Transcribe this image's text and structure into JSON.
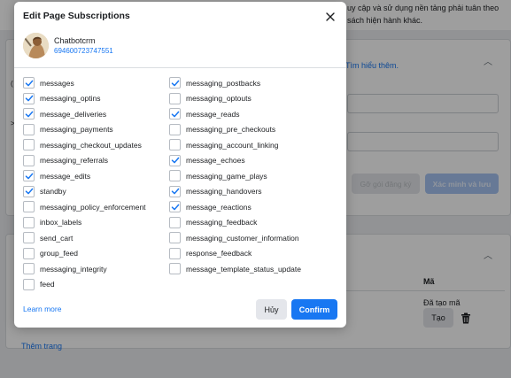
{
  "background": {
    "top_text_lines": [
      "uy cập và sử dụng nền tảng phải tuân theo",
      "sách hiện hành khác."
    ],
    "learn_more_link": "Tìm hiểu thêm.",
    "btn_register_plan": "Gỡ gói đăng ký",
    "btn_verify_save": "Xác minh và lưu",
    "table_col_header": "Mã",
    "token_status": "Đã tạo mã",
    "btn_create": "Tạo",
    "add_page_link": "Thêm trang"
  },
  "dialog": {
    "title": "Edit Page Subscriptions",
    "page_name": "Chatbotcrm",
    "page_id": "694600723747551",
    "learn_more": "Learn more",
    "cancel_label": "Hủy",
    "confirm_label": "Confirm",
    "left_fields": [
      {
        "label": "messages",
        "checked": true
      },
      {
        "label": "messaging_optins",
        "checked": true
      },
      {
        "label": "message_deliveries",
        "checked": true
      },
      {
        "label": "messaging_payments",
        "checked": false
      },
      {
        "label": "messaging_checkout_updates",
        "checked": false
      },
      {
        "label": "messaging_referrals",
        "checked": false
      },
      {
        "label": "message_edits",
        "checked": true
      },
      {
        "label": "standby",
        "checked": true
      },
      {
        "label": "messaging_policy_enforcement",
        "checked": false
      },
      {
        "label": "inbox_labels",
        "checked": false
      },
      {
        "label": "send_cart",
        "checked": false
      },
      {
        "label": "group_feed",
        "checked": false
      },
      {
        "label": "messaging_integrity",
        "checked": false
      },
      {
        "label": "feed",
        "checked": false
      }
    ],
    "right_fields": [
      {
        "label": "messaging_postbacks",
        "checked": true
      },
      {
        "label": "messaging_optouts",
        "checked": false
      },
      {
        "label": "message_reads",
        "checked": true
      },
      {
        "label": "messaging_pre_checkouts",
        "checked": false
      },
      {
        "label": "messaging_account_linking",
        "checked": false
      },
      {
        "label": "message_echoes",
        "checked": true
      },
      {
        "label": "messaging_game_plays",
        "checked": false
      },
      {
        "label": "messaging_handovers",
        "checked": true
      },
      {
        "label": "message_reactions",
        "checked": true
      },
      {
        "label": "messaging_feedback",
        "checked": false
      },
      {
        "label": "messaging_customer_information",
        "checked": false
      },
      {
        "label": "response_feedback",
        "checked": false
      },
      {
        "label": "message_template_status_update",
        "checked": false
      }
    ]
  },
  "colors": {
    "accent": "#1877f2",
    "overlay": "rgba(0,0,0,0.38)"
  }
}
